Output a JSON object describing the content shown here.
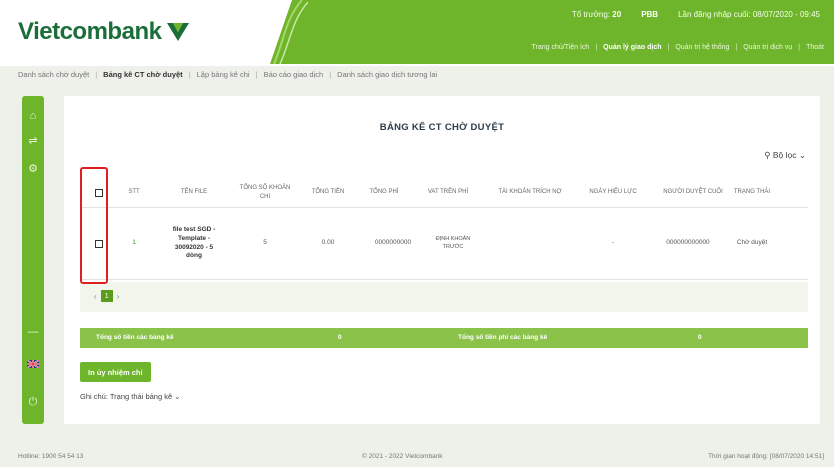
{
  "brand": {
    "name": "Vietcombank",
    "color": "#1b6e3a",
    "accent": "#6fb52c"
  },
  "header": {
    "info": {
      "tx_label": "Tổ trưởng:",
      "tx_value": "20",
      "code_label": "PBB",
      "login_label": "Lần đăng nhập cuối:",
      "login_value": "08/07/2020 - 09:45"
    },
    "nav": [
      "Trang chủ/Tiện ích",
      "Quản lý giao dịch",
      "Quản trị hệ thống",
      "Quản trị dịch vụ",
      "Thoát"
    ],
    "nav_active_index": 1
  },
  "subnav": {
    "items": [
      "Danh sách chờ duyệt",
      "Bảng kê CT chờ duyệt",
      "Lập bảng kê chi",
      "Báo cáo giao dịch",
      "Danh sách giao dịch tương lai"
    ],
    "active_index": 1
  },
  "sidebar": {
    "icons": [
      "home-icon",
      "transfer-icon",
      "settings-icon",
      "minus-icon",
      "flag-uk-icon",
      "power-icon"
    ]
  },
  "page": {
    "title": "BẢNG KÊ CT CHỜ DUYỆT",
    "filter_label": "Bộ lọc"
  },
  "table": {
    "headers": [
      "",
      "STT",
      "TÊN FILE",
      "TỔNG SỐ KHOẢN CHI",
      "TỔNG TIỀN",
      "TỔNG PHÍ",
      "VAT TRÊN PHÍ",
      "TÀI KHOẢN TRÍCH NỢ",
      "NGÀY HIỆU LỰC",
      "NGƯỜI DUYỆT CUỐI",
      "TRẠNG THÁI"
    ],
    "rows": [
      {
        "stt": "1",
        "file_name": "file test SGD - Template - 30092020 - 5 dòng",
        "count": "5",
        "amount": "0.00",
        "account": "0000000000",
        "debit_account": "ĐỊNH KHOẢN TRƯỚC",
        "effective_date": "-",
        "approver": "000000000000",
        "status": "Chờ duyệt"
      }
    ]
  },
  "pager": {
    "prev": "‹",
    "current": "1",
    "next": "›"
  },
  "totals": {
    "amount_label": "Tổng số tiền các bảng kê",
    "amount_value": "0",
    "fee_label": "Tổng số tiền phí các bảng kê",
    "fee_value": "0"
  },
  "actions": {
    "print_label": "In ủy nhiệm chi"
  },
  "note": "Ghi chú: Trạng thái bảng kê",
  "footer": {
    "hotline": "Hotline: 1900 54 54 13",
    "copyright": "© 2021 - 2022 Vietcombank",
    "last_login": "Thời gian hoạt động: [08/07/2020 14:51]"
  }
}
